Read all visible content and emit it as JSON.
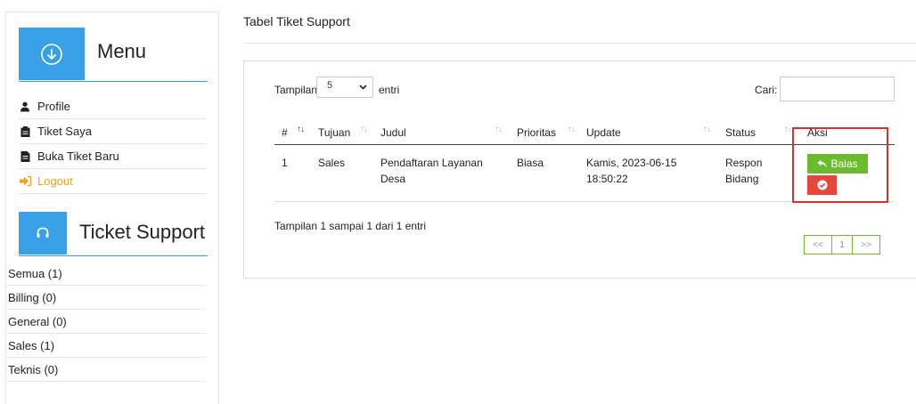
{
  "sidebar": {
    "menu_title": "Menu",
    "items": [
      {
        "label": "Profile",
        "icon": "user-icon"
      },
      {
        "label": "Tiket Saya",
        "icon": "clipboard-icon"
      },
      {
        "label": "Buka Tiket Baru",
        "icon": "document-icon"
      },
      {
        "label": "Logout",
        "icon": "logout-icon"
      }
    ],
    "ticket_title": "Ticket Support",
    "categories": [
      "Semua (1)",
      "Billing (0)",
      "General (0)",
      "Sales (1)",
      "Teknis (0)"
    ]
  },
  "main": {
    "page_title": "Tabel Tiket Support",
    "length_label": "Tampilan",
    "length_value": "5",
    "length_after": "entri",
    "search_label": "Cari:",
    "search_value": "",
    "columns": [
      "#",
      "Tujuan",
      "Judul",
      "Prioritas",
      "Update",
      "Status",
      "Aksi"
    ],
    "rows": [
      {
        "no": "1",
        "tujuan": "Sales",
        "judul_1": "Pendaftaran Layanan",
        "judul_2": "Desa",
        "prioritas": "Biasa",
        "update_1": "Kamis, 2023-06-15",
        "update_2": "18:50:22",
        "status_1": "Respon",
        "status_2": "Bidang"
      }
    ],
    "reply_button": "Balas",
    "info": "Tampilan 1 sampai 1 dari 1 entri",
    "pager": {
      "prev": "<<",
      "page": "1",
      "next": ">>"
    }
  },
  "colors": {
    "primary": "#3aa0e6",
    "success": "#6cba2e",
    "danger": "#e8453c",
    "warning": "#f0a21c",
    "highlight": "#d9322a"
  }
}
